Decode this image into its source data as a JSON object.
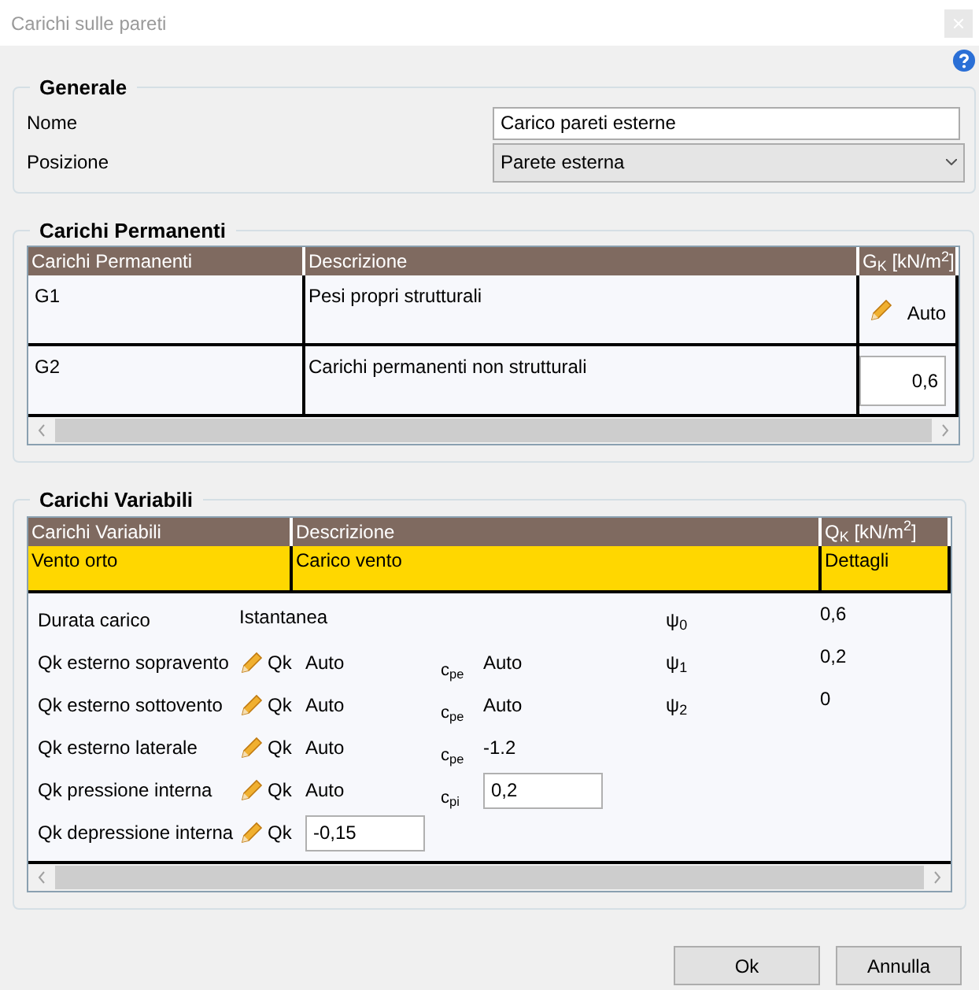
{
  "window": {
    "title": "Carichi sulle pareti"
  },
  "generale": {
    "title": "Generale",
    "fields": [
      {
        "label": "Nome",
        "kind": "input",
        "value": "Carico pareti esterne"
      },
      {
        "label": "Posizione",
        "kind": "select",
        "value": "Parete esterna"
      }
    ]
  },
  "permanenti": {
    "title": "Carichi Permanenti",
    "columns": [
      "Carichi Permanenti",
      "Descrizione",
      "G$_{K}$ [kN/m$^{2}$]"
    ],
    "rows": [
      {
        "name": "G1",
        "description": "Pesi propri strutturali",
        "kind": "auto",
        "value": "Auto"
      },
      {
        "name": "G2",
        "description": "Carichi permanenti non strutturali",
        "kind": "field",
        "value": "0,6"
      }
    ]
  },
  "variabili": {
    "title": "Carichi Variabili",
    "columns": [
      "Carichi Variabili",
      "Descrizione",
      "Q$_{K}$ [kN/m$^{2}$]"
    ],
    "rows": [
      {
        "name": "Vento orto",
        "description": "Carico vento",
        "value": "Dettagli",
        "selected": true
      }
    ],
    "details": [
      {
        "label": "Durata carico",
        "kind": "text",
        "value": "Istantanea",
        "psi": "ψ$_{0}$",
        "psi_value": "0,6"
      },
      {
        "label": "Qk esterno sopravento",
        "kind": "qk",
        "qk": "Qk",
        "value": "Auto",
        "value_field": false,
        "coef": "c$_{pe}$",
        "coef_value": "Auto",
        "coef_field": false,
        "psi": "ψ$_{1}$",
        "psi_value": "0,2"
      },
      {
        "label": "Qk esterno sottovento",
        "kind": "qk",
        "qk": "Qk",
        "value": "Auto",
        "value_field": false,
        "coef": "c$_{pe}$",
        "coef_value": "Auto",
        "coef_field": false,
        "psi": "ψ$_{2}$",
        "psi_value": "0"
      },
      {
        "label": "Qk esterno laterale",
        "kind": "qk",
        "qk": "Qk",
        "value": "Auto",
        "value_field": false,
        "coef": "c$_{pe}$",
        "coef_value": "-1.2",
        "coef_field": false
      },
      {
        "label": "Qk pressione interna",
        "kind": "qk",
        "qk": "Qk",
        "value": "Auto",
        "value_field": false,
        "coef": "c$_{pi}$",
        "coef_value": "0,2",
        "coef_field": true
      },
      {
        "label": "Qk depressione interna",
        "kind": "qk",
        "qk": "Qk",
        "value": "-0,15",
        "value_field": true
      }
    ]
  },
  "buttons": [
    "Ok",
    "Annulla"
  ]
}
